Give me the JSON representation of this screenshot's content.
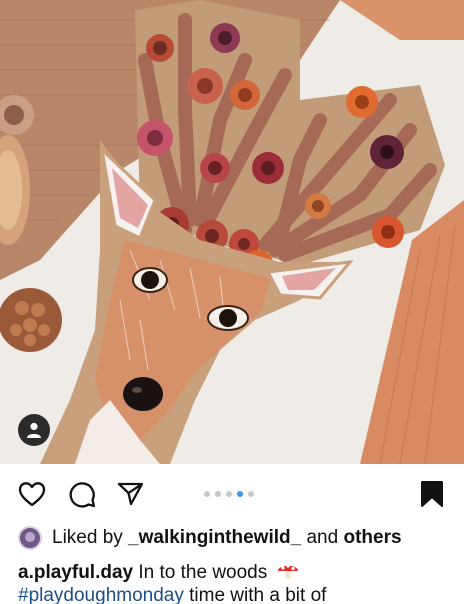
{
  "post": {
    "image_alt": "",
    "carousel": {
      "count": 5,
      "active_index": 3
    }
  },
  "icons": {
    "user_tag": "person-icon",
    "like": "heart-icon",
    "comment": "comment-bubble-icon",
    "share": "paper-plane-icon",
    "save": "bookmark-icon",
    "emoji": "mushroom-emoji"
  },
  "likes": {
    "prefix": "Liked by ",
    "user": "_walkinginthewild_",
    "connector": " and ",
    "others": "others"
  },
  "caption": {
    "username": "a.playful.day",
    "text": " In to the woods",
    "hashtag": "#playdoughmonday",
    "text2": " time with a bit of"
  },
  "colors": {
    "active_dot": "#3897f0",
    "inactive_dot": "#c8c8c8",
    "hashtag": "#1b4f8a",
    "bookmark": "#111111"
  }
}
